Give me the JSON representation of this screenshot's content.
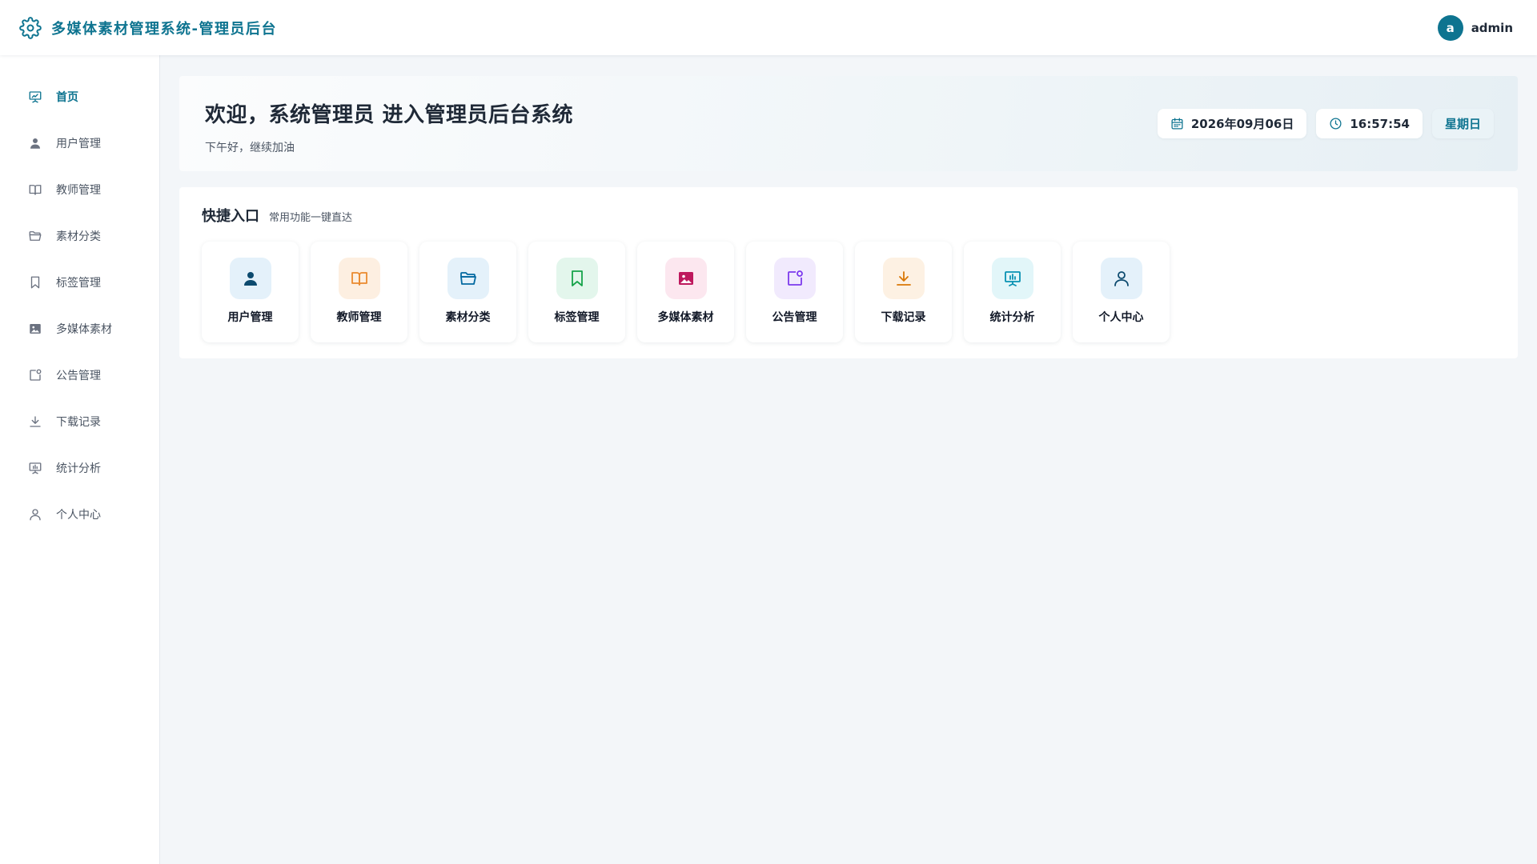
{
  "header": {
    "title": "多媒体素材管理系统-管理员后台",
    "logo_icon": "gear-icon",
    "user": {
      "avatar_letter": "a",
      "name": "admin"
    }
  },
  "sidebar": {
    "items": [
      {
        "label": "首页",
        "icon": "presentation-icon",
        "active": true
      },
      {
        "label": "用户管理",
        "icon": "user-icon"
      },
      {
        "label": "教师管理",
        "icon": "book-icon"
      },
      {
        "label": "素材分类",
        "icon": "folder-icon"
      },
      {
        "label": "标签管理",
        "icon": "bookmark-icon"
      },
      {
        "label": "多媒体素材",
        "icon": "image-icon"
      },
      {
        "label": "公告管理",
        "icon": "notice-icon"
      },
      {
        "label": "下载记录",
        "icon": "download-icon"
      },
      {
        "label": "统计分析",
        "icon": "chart-board-icon"
      },
      {
        "label": "个人中心",
        "icon": "person-icon"
      }
    ]
  },
  "welcome": {
    "title": "欢迎，系统管理员 进入管理员后台系统",
    "subtitle": "下午好，继续加油",
    "date": "2026年09月06日",
    "time": "16:57:54",
    "weekday": "星期日"
  },
  "quick": {
    "title": "快捷入口",
    "subtitle": "常用功能一键直达",
    "tiles": [
      {
        "label": "用户管理",
        "icon": "user-icon",
        "bg": "#e4f1fa",
        "color": "#0c4a6e"
      },
      {
        "label": "教师管理",
        "icon": "book-icon",
        "bg": "#fdefe1",
        "color": "#ea8a2e"
      },
      {
        "label": "素材分类",
        "icon": "folder-icon",
        "bg": "#e4f1fa",
        "color": "#0369a1"
      },
      {
        "label": "标签管理",
        "icon": "bookmark-icon",
        "bg": "#e3f6ec",
        "color": "#16a34a"
      },
      {
        "label": "多媒体素材",
        "icon": "image-icon",
        "bg": "#fce7ef",
        "color": "#be185d"
      },
      {
        "label": "公告管理",
        "icon": "notice-icon",
        "bg": "#f1eafd",
        "color": "#7c3aed"
      },
      {
        "label": "下载记录",
        "icon": "download-icon",
        "bg": "#fdf1e3",
        "color": "#d97706"
      },
      {
        "label": "统计分析",
        "icon": "chart-board-icon",
        "bg": "#e2f6f9",
        "color": "#0891b2"
      },
      {
        "label": "个人中心",
        "icon": "person-icon",
        "bg": "#e4f1fa",
        "color": "#0c4a6e"
      }
    ]
  },
  "colors": {
    "accent": "#0e7490",
    "background": "#f3f6f9"
  }
}
